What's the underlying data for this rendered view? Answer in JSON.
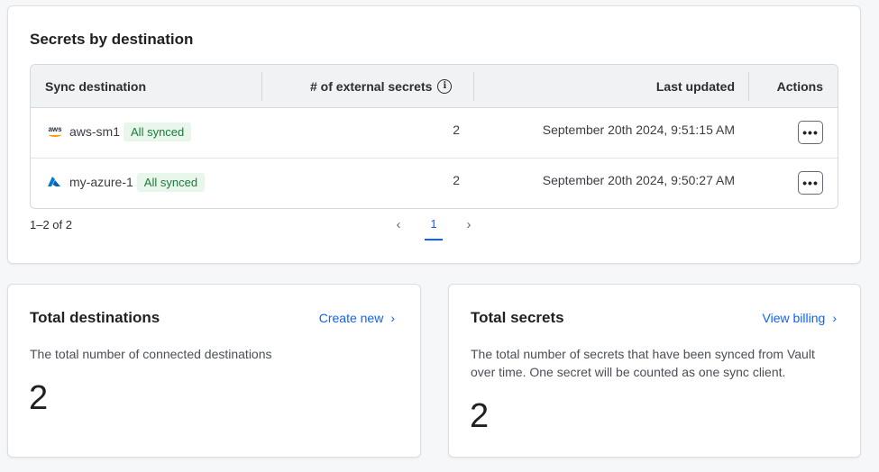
{
  "secrets_card": {
    "title": "Secrets by destination",
    "columns": {
      "destination": "Sync destination",
      "count": "# of external secrets",
      "updated": "Last updated",
      "actions": "Actions"
    },
    "rows": [
      {
        "icon": "aws-icon",
        "name": "aws-sm1",
        "status": "All synced",
        "count": "2",
        "updated": "September 20th 2024, 9:51:15 AM"
      },
      {
        "icon": "azure-icon",
        "name": "my-azure-1",
        "status": "All synced",
        "count": "2",
        "updated": "September 20th 2024, 9:50:27 AM"
      }
    ],
    "actions_label": "•••",
    "pagination": {
      "range": "1–2 of 2",
      "current_page": "1",
      "prev": "‹",
      "next": "›"
    }
  },
  "destinations_card": {
    "title": "Total destinations",
    "link": "Create new",
    "description": "The total number of connected destinations",
    "value": "2"
  },
  "secrets_total_card": {
    "title": "Total secrets",
    "link": "View billing",
    "description_line1": "The total number of secrets that have been synced from Vault",
    "description_line2": "over time. One secret will be counted as one sync client.",
    "value": "2"
  },
  "colors": {
    "link": "#1060ff",
    "badge_bg": "#e8f6ec",
    "badge_text": "#1b7a3a",
    "aws_orange": "#ff9900",
    "azure_blue": "#0078d4"
  }
}
